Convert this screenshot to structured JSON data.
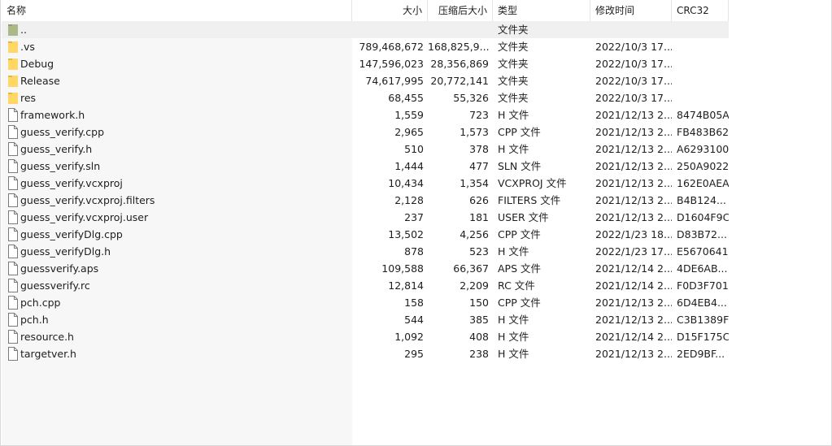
{
  "columns": {
    "name": "名称",
    "size": "大小",
    "packed": "压缩后大小",
    "type": "类型",
    "modified": "修改时间",
    "crc": "CRC32"
  },
  "sort_indicator": "^",
  "rows": [
    {
      "name": "..",
      "size": "",
      "packed": "",
      "type": "文件夹",
      "modified": "",
      "crc": "",
      "icon": "parent-folder-icon"
    },
    {
      "name": ".vs",
      "size": "789,468,672",
      "packed": "168,825,9...",
      "type": "文件夹",
      "modified": "2022/10/3 17...",
      "crc": "",
      "icon": "folder-icon"
    },
    {
      "name": "Debug",
      "size": "147,596,023",
      "packed": "28,356,869",
      "type": "文件夹",
      "modified": "2022/10/3 17...",
      "crc": "",
      "icon": "folder-icon"
    },
    {
      "name": "Release",
      "size": "74,617,995",
      "packed": "20,772,141",
      "type": "文件夹",
      "modified": "2022/10/3 17...",
      "crc": "",
      "icon": "folder-icon"
    },
    {
      "name": "res",
      "size": "68,455",
      "packed": "55,326",
      "type": "文件夹",
      "modified": "2022/10/3 17...",
      "crc": "",
      "icon": "folder-icon"
    },
    {
      "name": "framework.h",
      "size": "1,559",
      "packed": "723",
      "type": "H 文件",
      "modified": "2021/12/13 2...",
      "crc": "8474B05A",
      "icon": "file-icon"
    },
    {
      "name": "guess_verify.cpp",
      "size": "2,965",
      "packed": "1,573",
      "type": "CPP 文件",
      "modified": "2021/12/13 2...",
      "crc": "FB483B62",
      "icon": "file-icon"
    },
    {
      "name": "guess_verify.h",
      "size": "510",
      "packed": "378",
      "type": "H 文件",
      "modified": "2021/12/13 2...",
      "crc": "A6293100",
      "icon": "file-icon"
    },
    {
      "name": "guess_verify.sln",
      "size": "1,444",
      "packed": "477",
      "type": "SLN 文件",
      "modified": "2021/12/13 2...",
      "crc": "250A9022",
      "icon": "file-icon"
    },
    {
      "name": "guess_verify.vcxproj",
      "size": "10,434",
      "packed": "1,354",
      "type": "VCXPROJ 文件",
      "modified": "2021/12/13 2...",
      "crc": "162E0AEA",
      "icon": "file-icon"
    },
    {
      "name": "guess_verify.vcxproj.filters",
      "size": "2,128",
      "packed": "626",
      "type": "FILTERS 文件",
      "modified": "2021/12/13 2...",
      "crc": "B4B124...",
      "icon": "file-icon"
    },
    {
      "name": "guess_verify.vcxproj.user",
      "size": "237",
      "packed": "181",
      "type": "USER 文件",
      "modified": "2021/12/13 2...",
      "crc": "D1604F9C",
      "icon": "file-icon"
    },
    {
      "name": "guess_verifyDlg.cpp",
      "size": "13,502",
      "packed": "4,256",
      "type": "CPP 文件",
      "modified": "2022/1/23 18...",
      "crc": "D83B72...",
      "icon": "file-icon"
    },
    {
      "name": "guess_verifyDlg.h",
      "size": "878",
      "packed": "523",
      "type": "H 文件",
      "modified": "2022/1/23 17...",
      "crc": "E5670641",
      "icon": "file-icon"
    },
    {
      "name": "guessverify.aps",
      "size": "109,588",
      "packed": "66,367",
      "type": "APS 文件",
      "modified": "2021/12/14 2...",
      "crc": "4DE6AB...",
      "icon": "file-icon"
    },
    {
      "name": "guessverify.rc",
      "size": "12,814",
      "packed": "2,209",
      "type": "RC 文件",
      "modified": "2021/12/14 2...",
      "crc": "F0D3F701",
      "icon": "file-icon"
    },
    {
      "name": "pch.cpp",
      "size": "158",
      "packed": "150",
      "type": "CPP 文件",
      "modified": "2021/12/13 2...",
      "crc": "6D4EB4...",
      "icon": "file-icon"
    },
    {
      "name": "pch.h",
      "size": "544",
      "packed": "385",
      "type": "H 文件",
      "modified": "2021/12/13 2...",
      "crc": "C3B1389F",
      "icon": "file-icon"
    },
    {
      "name": "resource.h",
      "size": "1,092",
      "packed": "408",
      "type": "H 文件",
      "modified": "2021/12/14 2...",
      "crc": "D15F175C",
      "icon": "file-icon"
    },
    {
      "name": "targetver.h",
      "size": "295",
      "packed": "238",
      "type": "H 文件",
      "modified": "2021/12/13 2...",
      "crc": "2ED9BF...",
      "icon": "file-icon"
    }
  ],
  "colors": {
    "folder": "#ffd766",
    "folder_dark": "#e8b83a",
    "parent_folder": "#a9b98a",
    "file_outline": "#7a7a7a",
    "header_divider": "#e5e5e5",
    "name_column_bg": "#f7f7f7"
  }
}
